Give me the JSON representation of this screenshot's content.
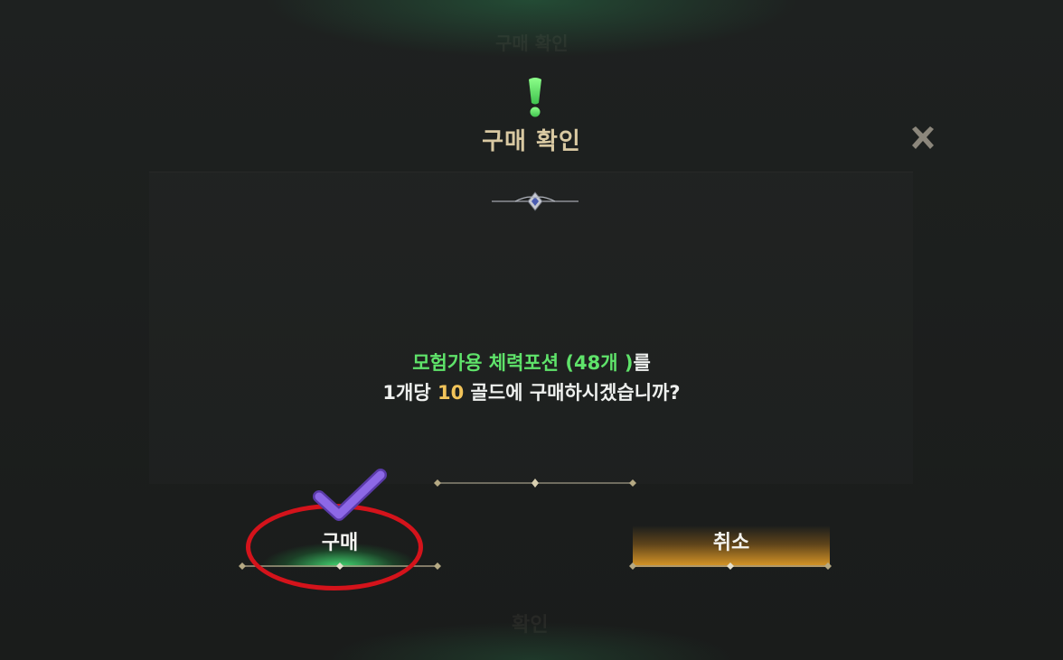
{
  "background": {
    "ghost_title": "구매 확인",
    "ghost_confirm": "확인"
  },
  "dialog": {
    "title": "구매 확인",
    "icon": "exclamation-icon",
    "close_icon": "close-x-icon",
    "message": {
      "item_name": "모험가용 체력포션",
      "open_paren": "(",
      "quantity": "48개",
      "close_paren": ")",
      "particle": "를",
      "line2_prefix": "1개당",
      "price": "10",
      "line2_suffix": "골드에 구매하시겠습니까?"
    },
    "buttons": {
      "buy_label": "구매",
      "cancel_label": "취소"
    }
  },
  "colors": {
    "accent_green": "#5fe36a",
    "accent_gold": "#f2c45a",
    "title_color": "#d9c9a2",
    "annotation_red": "#d4131b",
    "annotation_purple": "#7a55d6"
  },
  "annotations": {
    "highlight": "red-circle-around-buy-button",
    "mark": "purple-checkmark"
  }
}
